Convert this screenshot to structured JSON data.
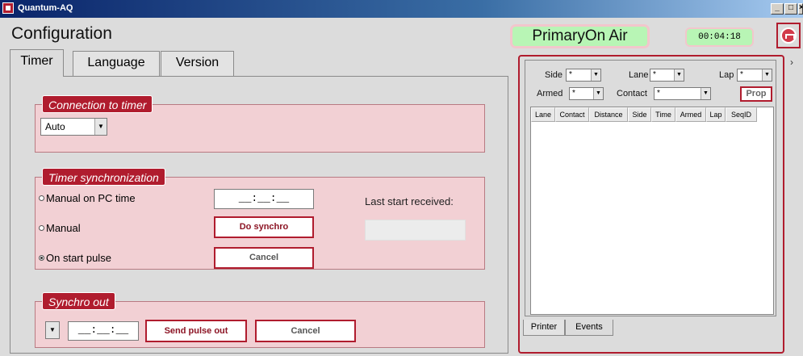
{
  "window": {
    "title": "Quantum-AQ",
    "min": "_",
    "max": "□",
    "close": "×"
  },
  "header": {
    "title": "Configuration",
    "status": "PrimaryOn Air",
    "clock": "00:04:18"
  },
  "tabs": [
    {
      "label": "Timer",
      "active": true
    },
    {
      "label": "Language",
      "active": false
    },
    {
      "label": "Version",
      "active": false
    }
  ],
  "connection": {
    "caption": "Connection to timer",
    "mode": "Auto"
  },
  "sync": {
    "caption": "Timer synchronization",
    "options": [
      {
        "label": "Manual on PC time",
        "checked": false
      },
      {
        "label": "Manual",
        "checked": false
      },
      {
        "label": "On start pulse",
        "checked": true
      }
    ],
    "time_value": "__:__:__",
    "do_synchro": "Do synchro",
    "cancel": "Cancel",
    "last_start_label": "Last start received:",
    "last_start_value": ""
  },
  "synchro_out": {
    "caption": "Synchro out",
    "time_value": "__:__:__",
    "send_pulse": "Send pulse out",
    "cancel": "Cancel"
  },
  "events_panel": {
    "filters": {
      "side_label": "Side",
      "side_value": "*",
      "lane_label": "Lane",
      "lane_value": "*",
      "lap_label": "Lap",
      "lap_value": "*",
      "armed_label": "Armed",
      "armed_value": "*",
      "contact_label": "Contact",
      "contact_value": "*",
      "prop_label": "Prop"
    },
    "columns": [
      "Lane",
      "Contact",
      "Distance",
      "Side",
      "Time",
      "Armed",
      "Lap",
      "SeqID"
    ],
    "tabs": [
      {
        "label": "Printer",
        "active": false
      },
      {
        "label": "Events",
        "active": true
      }
    ]
  },
  "colors": {
    "accent": "#b01c2e",
    "status_green": "#b8f5b5",
    "group_bg": "#f2d0d4"
  }
}
